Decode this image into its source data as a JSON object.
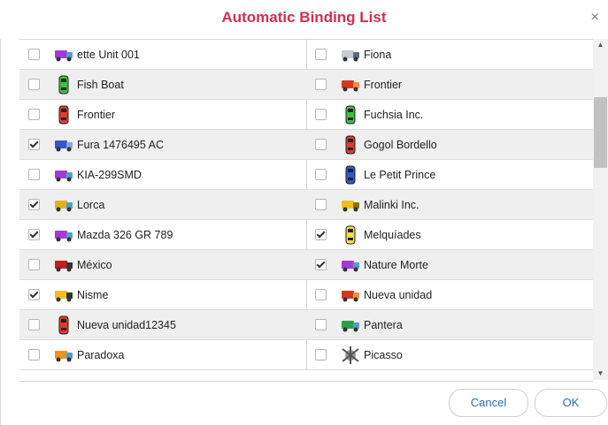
{
  "dialog": {
    "title": "Automatic Binding List",
    "close_glyph": "×"
  },
  "colors": {
    "title": "#d62d4b",
    "button_text": "#2a6ebd",
    "row_alt": "#efefef"
  },
  "left_items": [
    {
      "label": "ette Unit 001",
      "checked": false,
      "icon": "purple-truck-icon"
    },
    {
      "label": "Fish Boat",
      "checked": false,
      "icon": "green-car-icon"
    },
    {
      "label": "Frontier",
      "checked": false,
      "icon": "red-car-icon"
    },
    {
      "label": "Fura 1476495 AC",
      "checked": true,
      "icon": "blue-truck-icon"
    },
    {
      "label": "KIA-299SMD",
      "checked": false,
      "icon": "purple-truck-icon"
    },
    {
      "label": "Lorca",
      "checked": true,
      "icon": "yellow-truck-icon"
    },
    {
      "label": "Mazda 326 GR 789",
      "checked": true,
      "icon": "purple-truck-icon"
    },
    {
      "label": "México",
      "checked": false,
      "icon": "red-sports-car-icon"
    },
    {
      "label": "Nisme",
      "checked": true,
      "icon": "yellow-taxi-icon"
    },
    {
      "label": "Nueva unidad12345",
      "checked": false,
      "icon": "red-car-icon"
    },
    {
      "label": "Paradoxa",
      "checked": false,
      "icon": "orange-truck-icon"
    }
  ],
  "right_items": [
    {
      "label": "Fiona",
      "checked": false,
      "icon": "silver-car-icon"
    },
    {
      "label": "Frontier",
      "checked": false,
      "icon": "red-truck-icon"
    },
    {
      "label": "Fuchsia Inc.",
      "checked": false,
      "icon": "green-car-icon"
    },
    {
      "label": "Gogol Bordello",
      "checked": false,
      "icon": "red-car-icon"
    },
    {
      "label": "Le Petit Prince",
      "checked": false,
      "icon": "blue-car-icon"
    },
    {
      "label": "Malinki Inc.",
      "checked": false,
      "icon": "yellow-bus-icon"
    },
    {
      "label": "Melquíades",
      "checked": true,
      "icon": "yellow-car-icon"
    },
    {
      "label": "Nature Morte",
      "checked": true,
      "icon": "purple-truck-icon"
    },
    {
      "label": "Nueva unidad",
      "checked": false,
      "icon": "red-truck-icon"
    },
    {
      "label": "Pantera",
      "checked": false,
      "icon": "green-truck-icon"
    },
    {
      "label": "Picasso",
      "checked": false,
      "icon": "gray-robot-icon"
    }
  ],
  "buttons": {
    "cancel": "Cancel",
    "ok": "OK"
  }
}
